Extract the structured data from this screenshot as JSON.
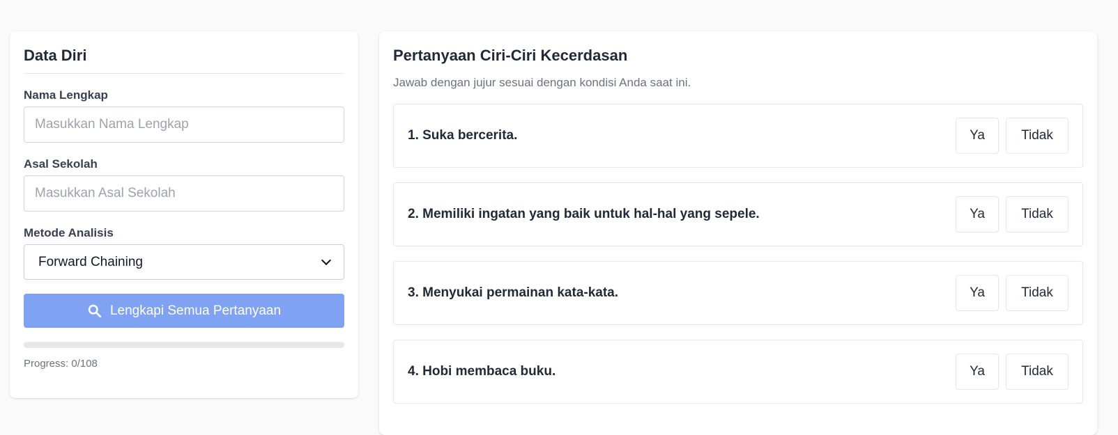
{
  "form": {
    "title": "Data Diri",
    "name_label": "Nama Lengkap",
    "name_placeholder": "Masukkan Nama Lengkap",
    "name_value": "",
    "school_label": "Asal Sekolah",
    "school_placeholder": "Masukkan Asal Sekolah",
    "school_value": "",
    "method_label": "Metode Analisis",
    "method_selected": "Forward Chaining",
    "submit_label": "Lengkapi Semua Pertanyaan",
    "submit_icon": "search-icon",
    "progress_text": "Progress: 0/108",
    "progress_fraction": 0
  },
  "questions": {
    "title": "Pertanyaan Ciri-Ciri Kecerdasan",
    "subtitle": "Jawab dengan jujur sesuai dengan kondisi Anda saat ini.",
    "yes_label": "Ya",
    "no_label": "Tidak",
    "items": [
      {
        "text": "1. Suka bercerita."
      },
      {
        "text": "2. Memiliki ingatan yang baik untuk hal-hal yang sepele."
      },
      {
        "text": "3. Menyukai permainan kata-kata."
      },
      {
        "text": "4. Hobi membaca buku."
      }
    ]
  },
  "colors": {
    "accent_button": "#7fa2f3",
    "progress_track": "#e5e7eb",
    "page_background": "#fafafa"
  }
}
